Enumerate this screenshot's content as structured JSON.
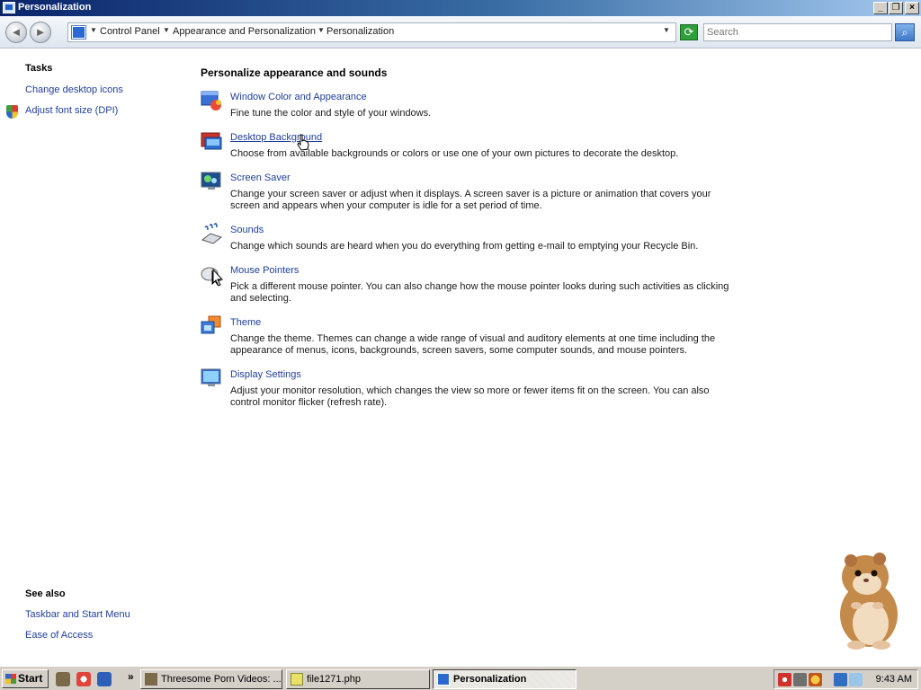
{
  "window": {
    "title": "Personalization"
  },
  "titlebar_buttons": {
    "minimize": "_",
    "maximize": "❐",
    "close": "×"
  },
  "address_bar": {
    "back_icon": "back-arrow-icon",
    "forward_icon": "forward-arrow-icon",
    "breadcrumbs": [
      "Control Panel",
      "Appearance and Personalization",
      "Personalization"
    ],
    "search_placeholder": "Search"
  },
  "sidebar": {
    "tasks_heading": "Tasks",
    "tasks": [
      {
        "label": "Change desktop icons"
      },
      {
        "label": "Adjust font size (DPI)",
        "icon": "shield-icon"
      }
    ],
    "see_also_heading": "See also",
    "see_also": [
      {
        "label": "Taskbar and Start Menu"
      },
      {
        "label": "Ease of Access"
      }
    ]
  },
  "main": {
    "heading": "Personalize appearance and sounds",
    "items": [
      {
        "title": "Window Color and Appearance",
        "icon": "window-color-icon",
        "description": "Fine tune the color and style of your windows."
      },
      {
        "title": "Desktop Background",
        "icon": "desktop-background-icon",
        "description": "Choose from available backgrounds or colors or use one of your own pictures to decorate the desktop."
      },
      {
        "title": "Screen Saver",
        "icon": "screen-saver-icon",
        "description": "Change your screen saver or adjust when it displays. A screen saver is a picture or animation that covers your screen and appears when your computer is idle for a set period of time."
      },
      {
        "title": "Sounds",
        "icon": "sounds-icon",
        "description": "Change which sounds are heard when you do everything from getting e-mail to emptying your Recycle Bin."
      },
      {
        "title": "Mouse Pointers",
        "icon": "mouse-icon",
        "description": "Pick a different mouse pointer. You can also change how the mouse pointer looks during such activities as clicking and selecting."
      },
      {
        "title": "Theme",
        "icon": "theme-icon",
        "description": "Change the theme. Themes can change a wide range of visual and auditory elements at one time including the appearance of menus, icons, backgrounds, screen savers, some computer sounds, and mouse pointers."
      },
      {
        "title": "Display Settings",
        "icon": "display-icon",
        "description": "Adjust your monitor resolution, which changes the view so more or fewer items fit on the screen. You can also control monitor flicker (refresh rate)."
      }
    ]
  },
  "taskbar": {
    "start_label": "Start",
    "quicklaunch_more": "»",
    "tasks": [
      {
        "label": "Threesome Porn Videos: ...",
        "active": false
      },
      {
        "label": "file1271.php",
        "active": false
      },
      {
        "label": "Personalization",
        "active": true
      }
    ],
    "clock": "9:43 AM"
  },
  "colors": {
    "link": "#1f3f9a",
    "titlebar_start": "#0a246a",
    "titlebar_end": "#a6caf0"
  }
}
